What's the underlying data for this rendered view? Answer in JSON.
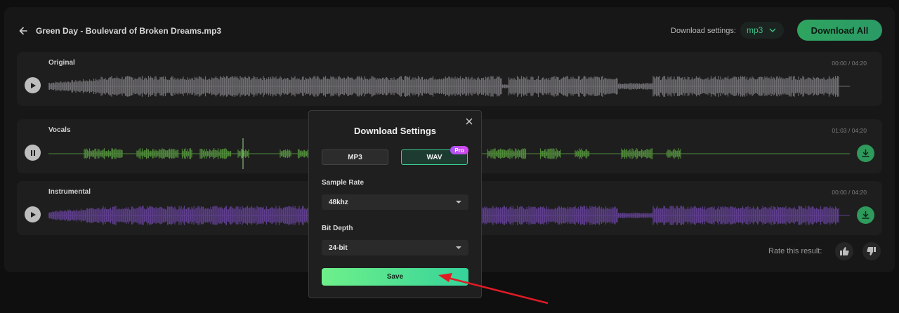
{
  "header": {
    "file_title": "Green Day - Boulevard of Broken Dreams.mp3",
    "download_settings_label": "Download settings:",
    "format_value": "mp3",
    "download_all_label": "Download All"
  },
  "tracks": [
    {
      "label": "Original",
      "time": "00:00 / 04:20",
      "state": "paused",
      "color": "#6f6d72"
    },
    {
      "label": "Vocals",
      "time": "01:03 / 04:20",
      "state": "playing",
      "color": "#4f8a3a"
    },
    {
      "label": "Instrumental",
      "time": "00:00 / 04:20",
      "state": "paused",
      "color": "#5e3e8c"
    }
  ],
  "rating": {
    "label": "Rate this result:"
  },
  "modal": {
    "title": "Download Settings",
    "format_mp3": "MP3",
    "format_wav": "WAV",
    "pro_badge": "Pro",
    "sample_rate_label": "Sample Rate",
    "sample_rate_value": "48khz",
    "bit_depth_label": "Bit Depth",
    "bit_depth_value": "24-bit",
    "save_label": "Save",
    "selected_format": "WAV"
  },
  "colors": {
    "accent": "#2ea45f",
    "annotation_arrow": "#e01b24"
  }
}
